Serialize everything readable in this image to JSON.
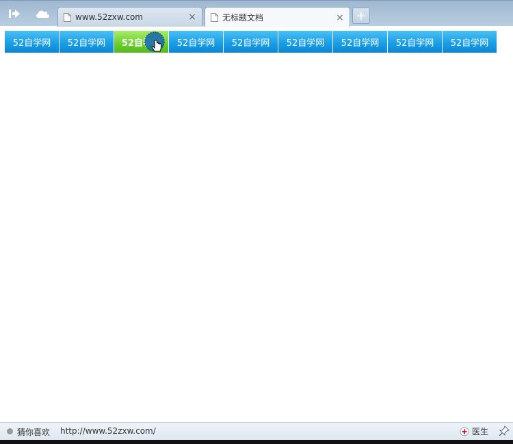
{
  "browser": {
    "tabs": [
      {
        "title": "www.52zxw.com",
        "active": false
      },
      {
        "title": "无标题文档",
        "active": true
      }
    ],
    "new_tab_label": "+",
    "close_glyph": "×"
  },
  "nav": {
    "items": [
      {
        "label": "52自学网"
      },
      {
        "label": "52自学网"
      },
      {
        "label": "52自学网",
        "hover": true
      },
      {
        "label": "52自学网"
      },
      {
        "label": "52自学网"
      },
      {
        "label": "52自学网"
      },
      {
        "label": "52自学网"
      },
      {
        "label": "52自学网"
      },
      {
        "label": "52自学网"
      }
    ],
    "colors": {
      "normal": "#1a9fe6",
      "hover": "#6ccf2e",
      "text": "#ffffff"
    }
  },
  "status": {
    "guess": "猜你喜欢",
    "url": "http://www.52zxw.com/",
    "doctor": "医生"
  },
  "icons": [
    "sidebar-toggle-icon",
    "cloud-icon",
    "page-icon",
    "close-icon",
    "plus-icon",
    "hand-cursor-icon",
    "doctor-icon",
    "pin-icon"
  ]
}
